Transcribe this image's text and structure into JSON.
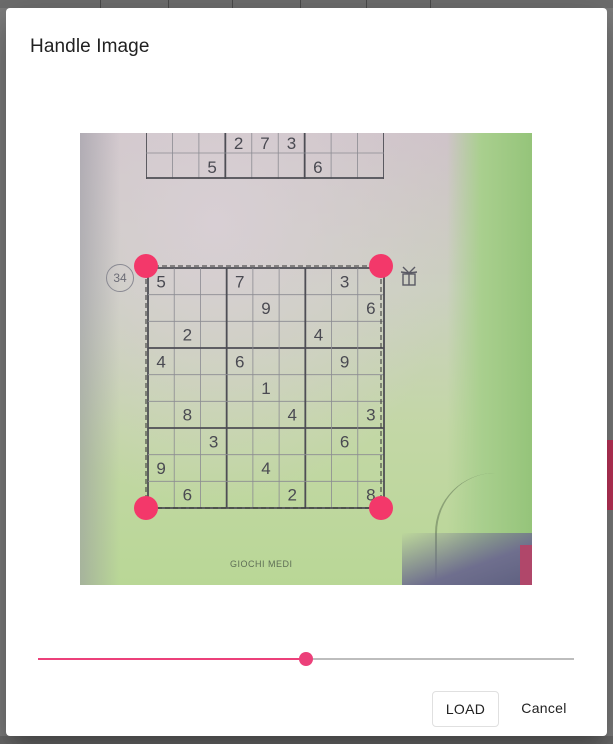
{
  "dialog": {
    "title": "Handle Image",
    "load_label": "LOAD",
    "cancel_label": "Cancel"
  },
  "image": {
    "puzzle_number": "34",
    "caption": "GIOCHI MEDI",
    "top_puzzle_row1": [
      "",
      "",
      "",
      "2",
      "7",
      "3",
      "",
      "",
      ""
    ],
    "top_puzzle_row2": [
      "",
      "",
      "5",
      "",
      "",
      "",
      "6",
      "",
      ""
    ],
    "sudoku": [
      [
        "5",
        "",
        "",
        "7",
        "",
        "",
        "",
        "3",
        ""
      ],
      [
        "",
        "",
        "",
        "",
        "9",
        "",
        "",
        "",
        "6"
      ],
      [
        "",
        "2",
        "",
        "",
        "",
        "",
        "4",
        "",
        ""
      ],
      [
        "4",
        "",
        "",
        "6",
        "",
        "",
        "",
        "9",
        ""
      ],
      [
        "",
        "",
        "",
        "",
        "1",
        "",
        "",
        "",
        ""
      ],
      [
        "",
        "8",
        "",
        "",
        "",
        "4",
        "",
        "",
        "3"
      ],
      [
        "",
        "",
        "3",
        "",
        "",
        "",
        "",
        "6",
        ""
      ],
      [
        "9",
        "",
        "",
        "",
        "4",
        "",
        "",
        "",
        ""
      ],
      [
        "",
        "6",
        "",
        "",
        "",
        "2",
        "",
        "",
        "8"
      ]
    ]
  },
  "slider": {
    "value": 0.5
  },
  "colors": {
    "accent": "#ec407a",
    "handle": "#f3386a"
  }
}
